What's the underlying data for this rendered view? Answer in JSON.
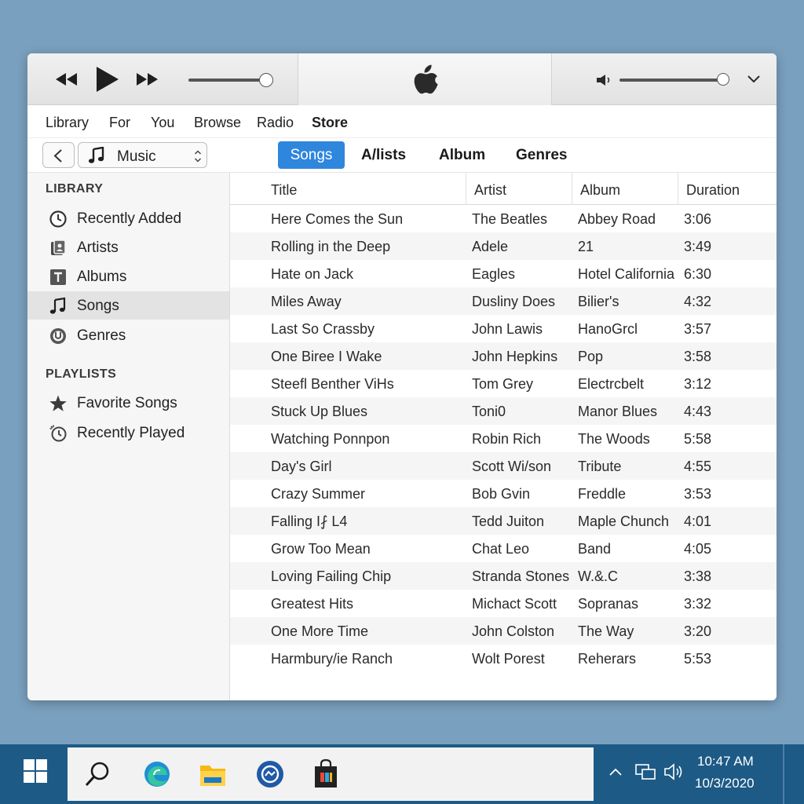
{
  "player": {
    "volume_percent": 100,
    "progress_percent": 100
  },
  "nav": {
    "items": [
      "Library",
      "For",
      "You",
      "Browse",
      "Radio",
      "Store"
    ],
    "active": "Store"
  },
  "toolbar": {
    "source_label": "Music",
    "tabs": [
      "Songs",
      "A/lists",
      "Album",
      "Genres"
    ],
    "active_tab": "Songs"
  },
  "sidebar": {
    "library_heading": "LIBRARY",
    "library_items": [
      {
        "label": "Recently Added",
        "icon": "clock-icon"
      },
      {
        "label": "Artists",
        "icon": "artists-icon"
      },
      {
        "label": "Albums",
        "icon": "albums-icon"
      },
      {
        "label": "Songs",
        "icon": "music-note-icon"
      },
      {
        "label": "Genres",
        "icon": "genres-icon"
      }
    ],
    "selected": "Songs",
    "playlists_heading": "PLAYLISTS",
    "playlist_items": [
      {
        "label": "Favorite Songs",
        "icon": "star-icon"
      },
      {
        "label": "Recently Played",
        "icon": "history-icon"
      }
    ]
  },
  "table": {
    "columns": [
      "Title",
      "Artist",
      "Album",
      "Duration"
    ],
    "rows": [
      [
        "Here Comes the Sun",
        "The Beatles",
        "Abbey Road",
        "3:06"
      ],
      [
        "Rolling in the Deep",
        "Adele",
        "21",
        "3:49"
      ],
      [
        "Hate on Jack",
        "Eagles",
        "Hotel California",
        "6:30"
      ],
      [
        "Miles Away",
        "Dusliny Does",
        "Bilier's",
        "4:32"
      ],
      [
        "Last So Crassby",
        "John Lawis",
        "HanoGrcl",
        "3:57"
      ],
      [
        "One Biree I Wake",
        "John Hepkins",
        "Pop",
        "3:58"
      ],
      [
        "Steefl Benther ViHs",
        "Tom Grey",
        "Electrcbelt",
        "3:12"
      ],
      [
        "Stuck Up Blues",
        "Toni0",
        "Manor Blues",
        "4:43"
      ],
      [
        "Watching Ponnpon",
        "Robin Rich",
        "The Woods",
        "5:58"
      ],
      [
        "Day's Girl",
        "Scott Wi/son",
        "Tribute",
        "4:55"
      ],
      [
        "Crazy Summer",
        "Bob Gvin",
        "Freddle",
        "3:53"
      ],
      [
        "Falling I⨏ L4",
        "Tedd Juiton",
        "Maple Chunch",
        "4:01"
      ],
      [
        "Grow Too Mean",
        "Chat Leo",
        "Band",
        "4:05"
      ],
      [
        "Loving Failing Chip",
        "Stranda Stones",
        "W.&.C",
        "3:38"
      ],
      [
        "Greatest Hits",
        "Michact Scott",
        "Sopranas",
        "3:32"
      ],
      [
        "One More Time",
        "John Colston",
        "The Way",
        "3:20"
      ],
      [
        "Harmbury/ie Ranch",
        "Wolt Porest",
        "Reherars",
        "5:53"
      ]
    ]
  },
  "taskbar": {
    "time": "10:47 AM",
    "date": "10/3/2020",
    "apps": [
      "windows-start-icon",
      "search-icon",
      "edge-icon",
      "file-explorer-icon",
      "messenger-icon",
      "store-icon"
    ]
  },
  "colors": {
    "accent": "#2f86dd",
    "desktop": "#7aa0bf",
    "taskbar": "#1d5a86"
  }
}
